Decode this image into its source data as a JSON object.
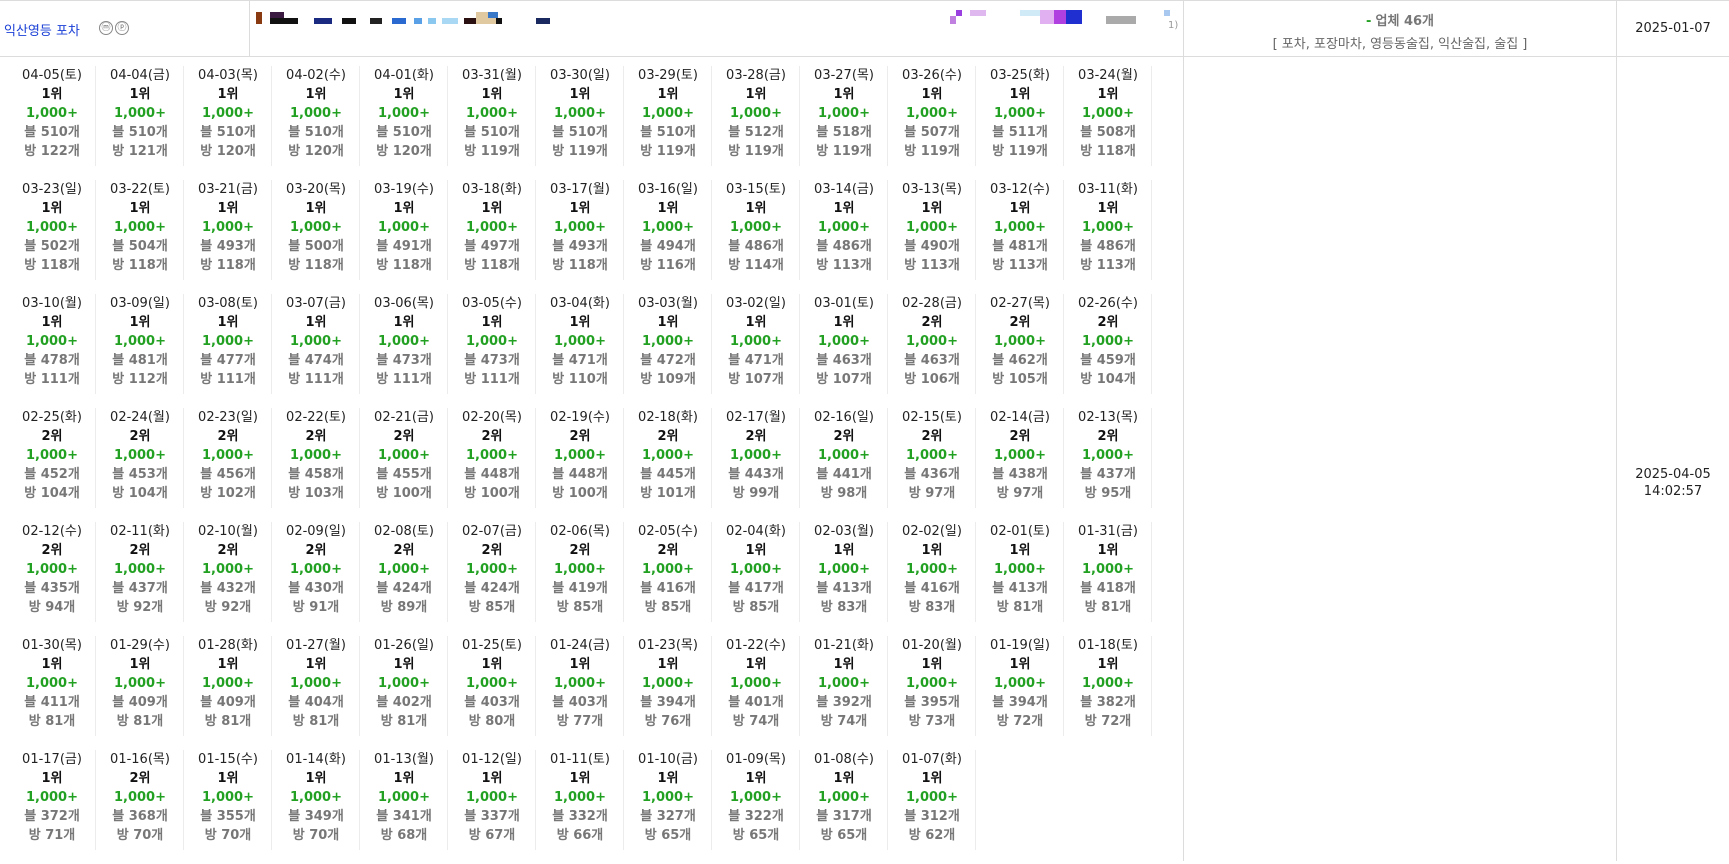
{
  "header": {
    "keyword": "익산영등 포차",
    "icons": [
      "m-circle-icon",
      "p-circle-icon"
    ],
    "icon_glyphs": [
      "ⓜ",
      "ⓟ"
    ],
    "dash": "-",
    "business_label": "업체 46개",
    "tags": "[ 포차, 포장마차, 영등동술집, 익산술집, 술집 ]",
    "registered_date": "2025-01-07",
    "updated_date": "2025-04-05",
    "updated_time": "14:02:57",
    "trail_char": "1)"
  },
  "colors": {
    "keyword": "#1a3fd6",
    "value": "#22a022",
    "muted": "#777777"
  },
  "days": [
    {
      "d": "04-05(토)",
      "r": "1위",
      "v": "1,000+",
      "b": "블 510개",
      "p": "방 122개"
    },
    {
      "d": "04-04(금)",
      "r": "1위",
      "v": "1,000+",
      "b": "블 510개",
      "p": "방 121개"
    },
    {
      "d": "04-03(목)",
      "r": "1위",
      "v": "1,000+",
      "b": "블 510개",
      "p": "방 120개"
    },
    {
      "d": "04-02(수)",
      "r": "1위",
      "v": "1,000+",
      "b": "블 510개",
      "p": "방 120개"
    },
    {
      "d": "04-01(화)",
      "r": "1위",
      "v": "1,000+",
      "b": "블 510개",
      "p": "방 120개"
    },
    {
      "d": "03-31(월)",
      "r": "1위",
      "v": "1,000+",
      "b": "블 510개",
      "p": "방 119개"
    },
    {
      "d": "03-30(일)",
      "r": "1위",
      "v": "1,000+",
      "b": "블 510개",
      "p": "방 119개"
    },
    {
      "d": "03-29(토)",
      "r": "1위",
      "v": "1,000+",
      "b": "블 510개",
      "p": "방 119개"
    },
    {
      "d": "03-28(금)",
      "r": "1위",
      "v": "1,000+",
      "b": "블 512개",
      "p": "방 119개"
    },
    {
      "d": "03-27(목)",
      "r": "1위",
      "v": "1,000+",
      "b": "블 518개",
      "p": "방 119개"
    },
    {
      "d": "03-26(수)",
      "r": "1위",
      "v": "1,000+",
      "b": "블 507개",
      "p": "방 119개"
    },
    {
      "d": "03-25(화)",
      "r": "1위",
      "v": "1,000+",
      "b": "블 511개",
      "p": "방 119개"
    },
    {
      "d": "03-24(월)",
      "r": "1위",
      "v": "1,000+",
      "b": "블 508개",
      "p": "방 118개"
    },
    {
      "d": "03-23(일)",
      "r": "1위",
      "v": "1,000+",
      "b": "블 502개",
      "p": "방 118개"
    },
    {
      "d": "03-22(토)",
      "r": "1위",
      "v": "1,000+",
      "b": "블 504개",
      "p": "방 118개"
    },
    {
      "d": "03-21(금)",
      "r": "1위",
      "v": "1,000+",
      "b": "블 493개",
      "p": "방 118개"
    },
    {
      "d": "03-20(목)",
      "r": "1위",
      "v": "1,000+",
      "b": "블 500개",
      "p": "방 118개"
    },
    {
      "d": "03-19(수)",
      "r": "1위",
      "v": "1,000+",
      "b": "블 491개",
      "p": "방 118개"
    },
    {
      "d": "03-18(화)",
      "r": "1위",
      "v": "1,000+",
      "b": "블 497개",
      "p": "방 118개"
    },
    {
      "d": "03-17(월)",
      "r": "1위",
      "v": "1,000+",
      "b": "블 493개",
      "p": "방 118개"
    },
    {
      "d": "03-16(일)",
      "r": "1위",
      "v": "1,000+",
      "b": "블 494개",
      "p": "방 116개"
    },
    {
      "d": "03-15(토)",
      "r": "1위",
      "v": "1,000+",
      "b": "블 486개",
      "p": "방 114개"
    },
    {
      "d": "03-14(금)",
      "r": "1위",
      "v": "1,000+",
      "b": "블 486개",
      "p": "방 113개"
    },
    {
      "d": "03-13(목)",
      "r": "1위",
      "v": "1,000+",
      "b": "블 490개",
      "p": "방 113개"
    },
    {
      "d": "03-12(수)",
      "r": "1위",
      "v": "1,000+",
      "b": "블 481개",
      "p": "방 113개"
    },
    {
      "d": "03-11(화)",
      "r": "1위",
      "v": "1,000+",
      "b": "블 486개",
      "p": "방 113개"
    },
    {
      "d": "03-10(월)",
      "r": "1위",
      "v": "1,000+",
      "b": "블 478개",
      "p": "방 111개"
    },
    {
      "d": "03-09(일)",
      "r": "1위",
      "v": "1,000+",
      "b": "블 481개",
      "p": "방 112개"
    },
    {
      "d": "03-08(토)",
      "r": "1위",
      "v": "1,000+",
      "b": "블 477개",
      "p": "방 111개"
    },
    {
      "d": "03-07(금)",
      "r": "1위",
      "v": "1,000+",
      "b": "블 474개",
      "p": "방 111개"
    },
    {
      "d": "03-06(목)",
      "r": "1위",
      "v": "1,000+",
      "b": "블 473개",
      "p": "방 111개"
    },
    {
      "d": "03-05(수)",
      "r": "1위",
      "v": "1,000+",
      "b": "블 473개",
      "p": "방 111개"
    },
    {
      "d": "03-04(화)",
      "r": "1위",
      "v": "1,000+",
      "b": "블 471개",
      "p": "방 110개"
    },
    {
      "d": "03-03(월)",
      "r": "1위",
      "v": "1,000+",
      "b": "블 472개",
      "p": "방 109개"
    },
    {
      "d": "03-02(일)",
      "r": "1위",
      "v": "1,000+",
      "b": "블 471개",
      "p": "방 107개"
    },
    {
      "d": "03-01(토)",
      "r": "1위",
      "v": "1,000+",
      "b": "블 463개",
      "p": "방 107개"
    },
    {
      "d": "02-28(금)",
      "r": "2위",
      "v": "1,000+",
      "b": "블 463개",
      "p": "방 106개"
    },
    {
      "d": "02-27(목)",
      "r": "2위",
      "v": "1,000+",
      "b": "블 462개",
      "p": "방 105개"
    },
    {
      "d": "02-26(수)",
      "r": "2위",
      "v": "1,000+",
      "b": "블 459개",
      "p": "방 104개"
    },
    {
      "d": "02-25(화)",
      "r": "2위",
      "v": "1,000+",
      "b": "블 452개",
      "p": "방 104개"
    },
    {
      "d": "02-24(월)",
      "r": "2위",
      "v": "1,000+",
      "b": "블 453개",
      "p": "방 104개"
    },
    {
      "d": "02-23(일)",
      "r": "2위",
      "v": "1,000+",
      "b": "블 456개",
      "p": "방 102개"
    },
    {
      "d": "02-22(토)",
      "r": "2위",
      "v": "1,000+",
      "b": "블 458개",
      "p": "방 103개"
    },
    {
      "d": "02-21(금)",
      "r": "2위",
      "v": "1,000+",
      "b": "블 455개",
      "p": "방 100개"
    },
    {
      "d": "02-20(목)",
      "r": "2위",
      "v": "1,000+",
      "b": "블 448개",
      "p": "방 100개"
    },
    {
      "d": "02-19(수)",
      "r": "2위",
      "v": "1,000+",
      "b": "블 448개",
      "p": "방 100개"
    },
    {
      "d": "02-18(화)",
      "r": "2위",
      "v": "1,000+",
      "b": "블 445개",
      "p": "방 101개"
    },
    {
      "d": "02-17(월)",
      "r": "2위",
      "v": "1,000+",
      "b": "블 443개",
      "p": "방 99개"
    },
    {
      "d": "02-16(일)",
      "r": "2위",
      "v": "1,000+",
      "b": "블 441개",
      "p": "방 98개"
    },
    {
      "d": "02-15(토)",
      "r": "2위",
      "v": "1,000+",
      "b": "블 436개",
      "p": "방 97개"
    },
    {
      "d": "02-14(금)",
      "r": "2위",
      "v": "1,000+",
      "b": "블 438개",
      "p": "방 97개"
    },
    {
      "d": "02-13(목)",
      "r": "2위",
      "v": "1,000+",
      "b": "블 437개",
      "p": "방 95개"
    },
    {
      "d": "02-12(수)",
      "r": "2위",
      "v": "1,000+",
      "b": "블 435개",
      "p": "방 94개"
    },
    {
      "d": "02-11(화)",
      "r": "2위",
      "v": "1,000+",
      "b": "블 437개",
      "p": "방 92개"
    },
    {
      "d": "02-10(월)",
      "r": "2위",
      "v": "1,000+",
      "b": "블 432개",
      "p": "방 92개"
    },
    {
      "d": "02-09(일)",
      "r": "2위",
      "v": "1,000+",
      "b": "블 430개",
      "p": "방 91개"
    },
    {
      "d": "02-08(토)",
      "r": "2위",
      "v": "1,000+",
      "b": "블 424개",
      "p": "방 89개"
    },
    {
      "d": "02-07(금)",
      "r": "2위",
      "v": "1,000+",
      "b": "블 424개",
      "p": "방 85개"
    },
    {
      "d": "02-06(목)",
      "r": "2위",
      "v": "1,000+",
      "b": "블 419개",
      "p": "방 85개"
    },
    {
      "d": "02-05(수)",
      "r": "2위",
      "v": "1,000+",
      "b": "블 416개",
      "p": "방 85개"
    },
    {
      "d": "02-04(화)",
      "r": "1위",
      "v": "1,000+",
      "b": "블 417개",
      "p": "방 85개"
    },
    {
      "d": "02-03(월)",
      "r": "1위",
      "v": "1,000+",
      "b": "블 413개",
      "p": "방 83개"
    },
    {
      "d": "02-02(일)",
      "r": "1위",
      "v": "1,000+",
      "b": "블 416개",
      "p": "방 83개"
    },
    {
      "d": "02-01(토)",
      "r": "1위",
      "v": "1,000+",
      "b": "블 413개",
      "p": "방 81개"
    },
    {
      "d": "01-31(금)",
      "r": "1위",
      "v": "1,000+",
      "b": "블 418개",
      "p": "방 81개"
    },
    {
      "d": "01-30(목)",
      "r": "1위",
      "v": "1,000+",
      "b": "블 411개",
      "p": "방 81개"
    },
    {
      "d": "01-29(수)",
      "r": "1위",
      "v": "1,000+",
      "b": "블 409개",
      "p": "방 81개"
    },
    {
      "d": "01-28(화)",
      "r": "1위",
      "v": "1,000+",
      "b": "블 409개",
      "p": "방 81개"
    },
    {
      "d": "01-27(월)",
      "r": "1위",
      "v": "1,000+",
      "b": "블 404개",
      "p": "방 81개"
    },
    {
      "d": "01-26(일)",
      "r": "1위",
      "v": "1,000+",
      "b": "블 402개",
      "p": "방 81개"
    },
    {
      "d": "01-25(토)",
      "r": "1위",
      "v": "1,000+",
      "b": "블 403개",
      "p": "방 80개"
    },
    {
      "d": "01-24(금)",
      "r": "1위",
      "v": "1,000+",
      "b": "블 403개",
      "p": "방 77개"
    },
    {
      "d": "01-23(목)",
      "r": "1위",
      "v": "1,000+",
      "b": "블 394개",
      "p": "방 76개"
    },
    {
      "d": "01-22(수)",
      "r": "1위",
      "v": "1,000+",
      "b": "블 401개",
      "p": "방 74개"
    },
    {
      "d": "01-21(화)",
      "r": "1위",
      "v": "1,000+",
      "b": "블 392개",
      "p": "방 74개"
    },
    {
      "d": "01-20(월)",
      "r": "1위",
      "v": "1,000+",
      "b": "블 395개",
      "p": "방 73개"
    },
    {
      "d": "01-19(일)",
      "r": "1위",
      "v": "1,000+",
      "b": "블 394개",
      "p": "방 72개"
    },
    {
      "d": "01-18(토)",
      "r": "1위",
      "v": "1,000+",
      "b": "블 382개",
      "p": "방 72개"
    },
    {
      "d": "01-17(금)",
      "r": "1위",
      "v": "1,000+",
      "b": "블 372개",
      "p": "방 71개"
    },
    {
      "d": "01-16(목)",
      "r": "2위",
      "v": "1,000+",
      "b": "블 368개",
      "p": "방 70개"
    },
    {
      "d": "01-15(수)",
      "r": "1위",
      "v": "1,000+",
      "b": "블 355개",
      "p": "방 70개"
    },
    {
      "d": "01-14(화)",
      "r": "1위",
      "v": "1,000+",
      "b": "블 349개",
      "p": "방 70개"
    },
    {
      "d": "01-13(월)",
      "r": "1위",
      "v": "1,000+",
      "b": "블 341개",
      "p": "방 68개"
    },
    {
      "d": "01-12(일)",
      "r": "1위",
      "v": "1,000+",
      "b": "블 337개",
      "p": "방 67개"
    },
    {
      "d": "01-11(토)",
      "r": "1위",
      "v": "1,000+",
      "b": "블 332개",
      "p": "방 66개"
    },
    {
      "d": "01-10(금)",
      "r": "1위",
      "v": "1,000+",
      "b": "블 327개",
      "p": "방 65개"
    },
    {
      "d": "01-09(목)",
      "r": "1위",
      "v": "1,000+",
      "b": "블 322개",
      "p": "방 65개"
    },
    {
      "d": "01-08(수)",
      "r": "1위",
      "v": "1,000+",
      "b": "블 317개",
      "p": "방 65개"
    },
    {
      "d": "01-07(화)",
      "r": "1위",
      "v": "1,000+",
      "b": "블 312개",
      "p": "방 62개"
    }
  ]
}
